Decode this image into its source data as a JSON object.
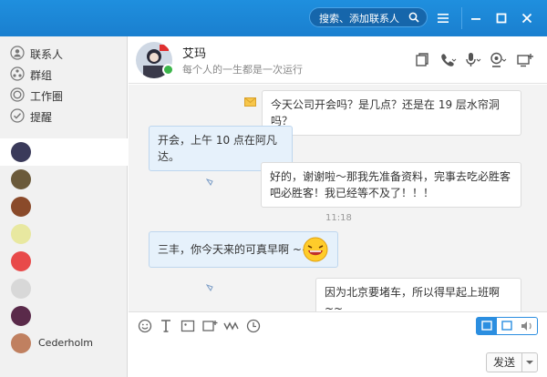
{
  "titlebar": {
    "search_placeholder": "搜索、添加联系人",
    "icons": [
      "search-icon",
      "menu-icon",
      "minimize-icon",
      "maximize-icon",
      "close-icon"
    ]
  },
  "sidebar": {
    "nav": [
      {
        "label": "联系人",
        "icon": "contacts-icon"
      },
      {
        "label": "群组",
        "icon": "group-icon"
      },
      {
        "label": "工作圈",
        "icon": "circle-icon"
      },
      {
        "label": "提醒",
        "icon": "check-icon"
      }
    ],
    "contacts": [
      {
        "name": "",
        "color": "#3a3a5a",
        "selected": true
      },
      {
        "name": "",
        "color": "#6b5a3a"
      },
      {
        "name": "",
        "color": "#8a4a2a"
      },
      {
        "name": "",
        "color": "#e8e8a0"
      },
      {
        "name": "",
        "color": "#e84a4a"
      },
      {
        "name": "",
        "color": "#d8d8d8"
      },
      {
        "name": "",
        "color": "#5a2a4a"
      },
      {
        "name": "Cederholm",
        "color": "#c08060"
      }
    ]
  },
  "chat": {
    "name": "艾玛",
    "signature": "每个人的一生都是一次运行",
    "header_icons": [
      "copy-icon",
      "phone-icon",
      "microphone-icon",
      "webcam-icon",
      "screen-share-icon"
    ],
    "time_divider": "11:18",
    "messages": [
      {
        "dir": "out",
        "text": "今天公司开会吗？是几点？还是在 19 层水帘洞吗？"
      },
      {
        "dir": "in",
        "text": "开会，上午 10 点在阿凡达。"
      },
      {
        "dir": "out",
        "text": "好的，谢谢啦～那我先准备资料，完事去吃必胜客吧必胜客！我已经等不及了！！！"
      },
      {
        "dir": "in",
        "text": "三丰，你今天来的可真早啊 ~~"
      },
      {
        "dir": "out",
        "text": "因为北京要堵车，所以得早起上班啊 ~~"
      }
    ]
  },
  "input": {
    "tools": [
      "emoji-icon",
      "font-icon",
      "image-icon",
      "screenshot-icon",
      "shake-icon",
      "history-icon"
    ],
    "send_label": "发送",
    "accent": "#2b8ee0"
  }
}
